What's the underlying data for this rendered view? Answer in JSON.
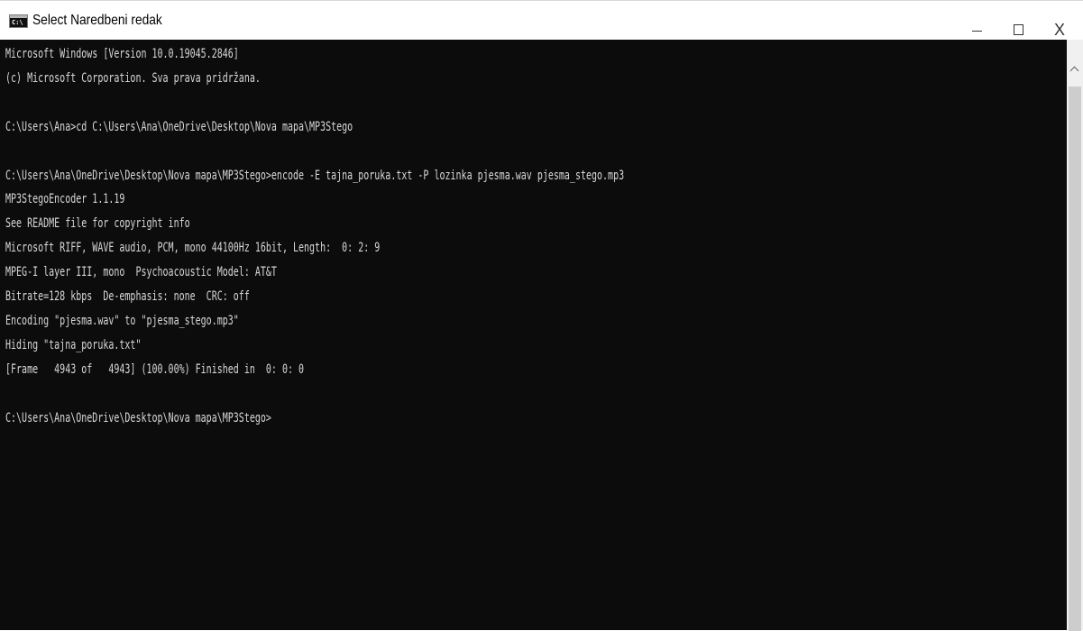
{
  "window": {
    "title": "Select Naredbeni redak",
    "icon_label": "C:\\",
    "icon": "cmd-icon",
    "close_glyph": "X"
  },
  "console": {
    "text_color": "#d8d8d8",
    "background": "#0c0c0c",
    "lines": [
      "Microsoft Windows [Version 10.0.19045.2846]",
      "(c) Microsoft Corporation. Sva prava pridržana.",
      "",
      "C:\\Users\\Ana>cd C:\\Users\\Ana\\OneDrive\\Desktop\\Nova mapa\\MP3Stego",
      "",
      "C:\\Users\\Ana\\OneDrive\\Desktop\\Nova mapa\\MP3Stego>encode -E tajna_poruka.txt -P lozinka pjesma.wav pjesma_stego.mp3",
      "MP3StegoEncoder 1.1.19",
      "See README file for copyright info",
      "Microsoft RIFF, WAVE audio, PCM, mono 44100Hz 16bit, Length:  0: 2: 9",
      "MPEG-I layer III, mono  Psychoacoustic Model: AT&T",
      "Bitrate=128 kbps  De-emphasis: none  CRC: off",
      "Encoding \"pjesma.wav\" to \"pjesma_stego.mp3\"",
      "Hiding \"tajna_poruka.txt\"",
      "[Frame   4943 of   4943] (100.00%) Finished in  0: 0: 0",
      "",
      "C:\\Users\\Ana\\OneDrive\\Desktop\\Nova mapa\\MP3Stego>"
    ]
  }
}
